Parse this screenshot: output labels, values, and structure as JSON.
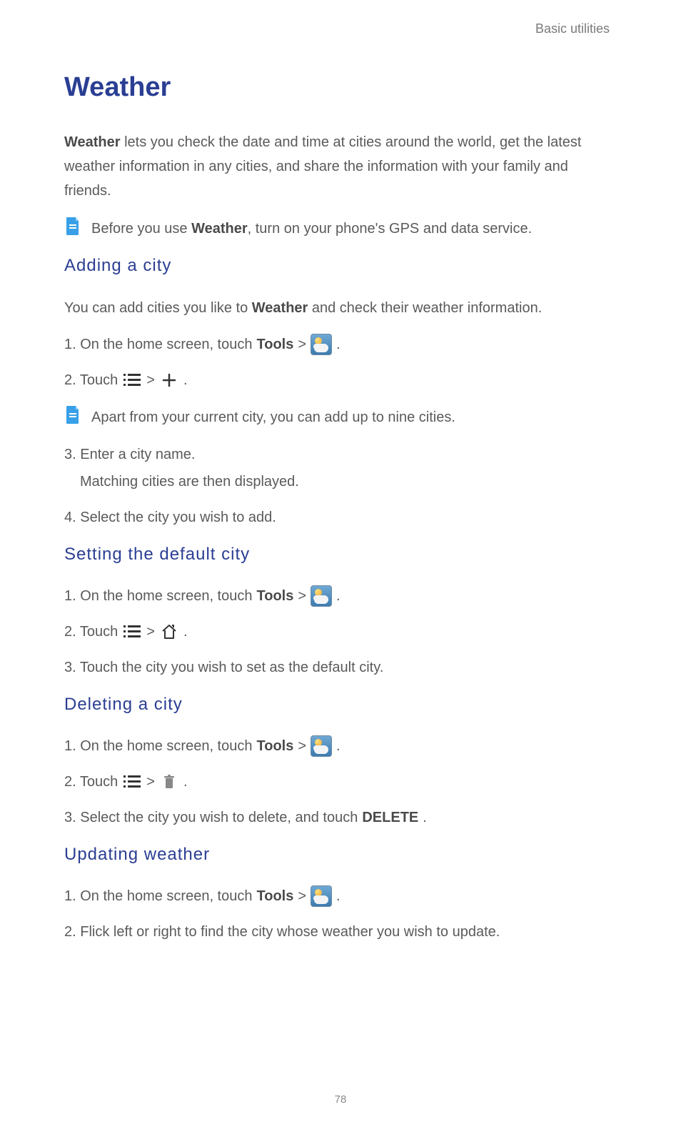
{
  "header": {
    "category": "Basic utilities"
  },
  "page_number": "78",
  "title": "Weather",
  "intro": {
    "prefix_bold": "Weather",
    "rest": " lets you check the date and time at cities around the world, get the latest weather information in any cities, and share the information with your family and friends."
  },
  "note_gps": {
    "pre": "Before you use ",
    "bold": "Weather",
    "post": ", turn on your phone's GPS and data service."
  },
  "sections": {
    "adding": {
      "heading": "Adding a city",
      "desc_pre": "You can add cities you like to ",
      "desc_bold": "Weather",
      "desc_post": " and check their weather information.",
      "step1_pre": "1. On the home screen, touch ",
      "step1_bold": "Tools",
      "step1_gt": " > ",
      "step1_end": " .",
      "step2_pre": "2. Touch ",
      "step2_gt": " > ",
      "step2_end": " .",
      "note": "Apart from your current city, you can add up to nine cities.",
      "step3": "3. Enter a city name.",
      "step3_sub": "Matching cities are then displayed.",
      "step4": "4. Select the city you wish to add."
    },
    "default": {
      "heading": "Setting the default city",
      "step1_pre": "1. On the home screen, touch ",
      "step1_bold": "Tools",
      "step1_gt": " > ",
      "step1_end": " .",
      "step2_pre": "2. Touch ",
      "step2_gt": " > ",
      "step2_end": " .",
      "step3": "3. Touch the city you wish to set as the default city."
    },
    "deleting": {
      "heading": "Deleting a city",
      "step1_pre": "1. On the home screen, touch ",
      "step1_bold": "Tools",
      "step1_gt": " > ",
      "step1_end": " .",
      "step2_pre": "2. Touch ",
      "step2_gt": " > ",
      "step2_end": " .",
      "step3_pre": "3. Select the city you wish to delete, and touch ",
      "step3_bold": "DELETE",
      "step3_end": "."
    },
    "updating": {
      "heading": "Updating weather",
      "step1_pre": "1. On the home screen, touch ",
      "step1_bold": "Tools",
      "step1_gt": " > ",
      "step1_end": " .",
      "step2": "2. Flick left or right to find the city whose weather you wish to update."
    }
  }
}
